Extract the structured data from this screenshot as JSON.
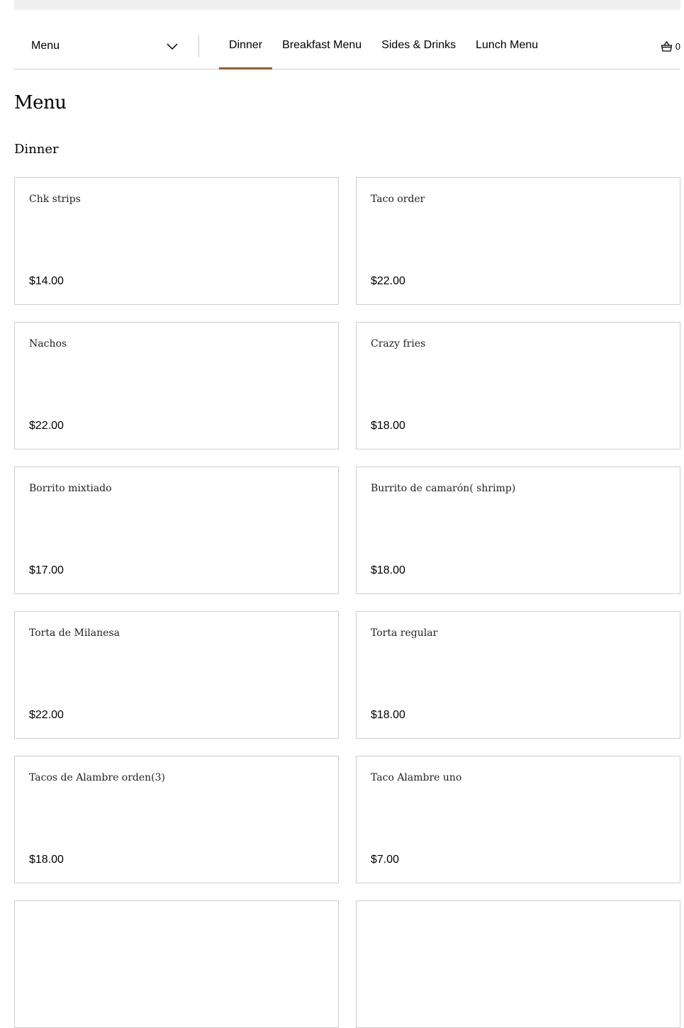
{
  "nav": {
    "menu_select_label": "Menu",
    "tabs": [
      {
        "label": "Dinner",
        "active": true
      },
      {
        "label": "Breakfast Menu",
        "active": false
      },
      {
        "label": "Sides & Drinks",
        "active": false
      },
      {
        "label": "Lunch Menu",
        "active": false
      }
    ],
    "cart_count": "0",
    "accent_color": "#9b5a25"
  },
  "page": {
    "title": "Menu",
    "section_title": "Dinner"
  },
  "items": [
    {
      "name": "Chk strips",
      "price": "$14.00"
    },
    {
      "name": "Taco order",
      "price": "$22.00"
    },
    {
      "name": "Nachos",
      "price": "$22.00"
    },
    {
      "name": "Crazy fries",
      "price": "$18.00"
    },
    {
      "name": "Borrito mixtiado",
      "price": "$17.00"
    },
    {
      "name": "Burrito de camarón( shrimp)",
      "price": "$18.00"
    },
    {
      "name": "Torta de Milanesa",
      "price": "$22.00"
    },
    {
      "name": "Torta regular",
      "price": "$18.00"
    },
    {
      "name": "Tacos de Alambre orden(3)",
      "price": "$18.00"
    },
    {
      "name": "Taco Alambre uno",
      "price": "$7.00"
    },
    {
      "name": "",
      "price": ""
    },
    {
      "name": "",
      "price": ""
    }
  ]
}
